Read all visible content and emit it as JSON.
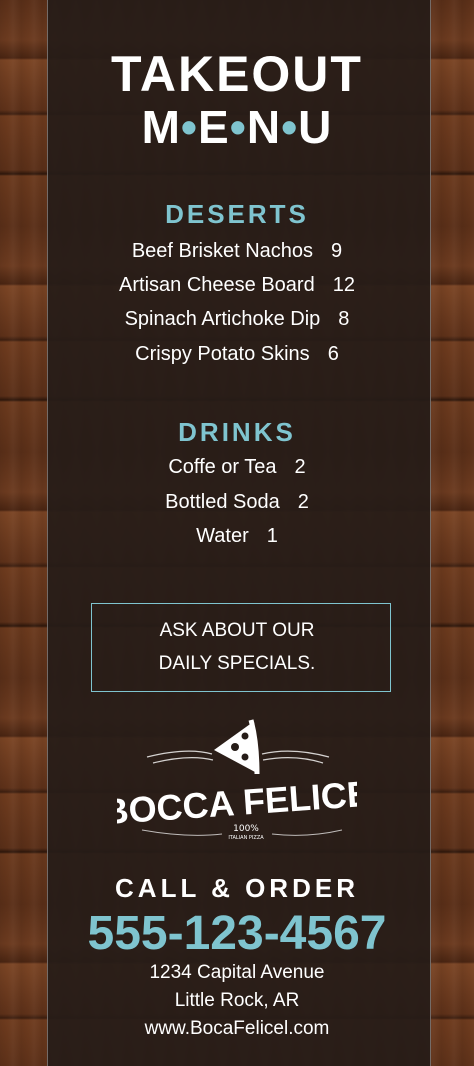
{
  "header": {
    "title_line1": "TAKEOUT",
    "title_line2_letters": [
      "M",
      "E",
      "N",
      "U"
    ],
    "title_line2_separator": "•"
  },
  "deserts": {
    "heading": "DESERTS",
    "items": [
      {
        "name": "Beef Brisket Nachos",
        "price": "9"
      },
      {
        "name": "Artisan Cheese Board",
        "price": "12"
      },
      {
        "name": "Spinach Artichoke Dip",
        "price": "8"
      },
      {
        "name": "Crispy Potato Skins",
        "price": "6"
      }
    ]
  },
  "drinks": {
    "heading": "DRINKS",
    "items": [
      {
        "name": "Coffe or Tea",
        "price": "2"
      },
      {
        "name": "Bottled Soda",
        "price": "2"
      },
      {
        "name": "Water",
        "price": "1"
      }
    ]
  },
  "specials": {
    "line1": "ASK ABOUT OUR",
    "line2": "DAILY SPECIALS."
  },
  "logo": {
    "name": "BOCCA FELICE",
    "tagline_percent": "100%",
    "tagline": "ITALIAN PIZZA",
    "icon": "pizza-slice-icon"
  },
  "contact": {
    "call_label": "CALL & ORDER",
    "phone": "555-123-4567",
    "address_line1": "1234 Capital Avenue",
    "address_line2": "Little Rock, AR",
    "website": "www.BocaFelicel.com"
  },
  "colors": {
    "accent": "#7fc4cf",
    "panel": "#261c18",
    "text": "#ffffff"
  }
}
